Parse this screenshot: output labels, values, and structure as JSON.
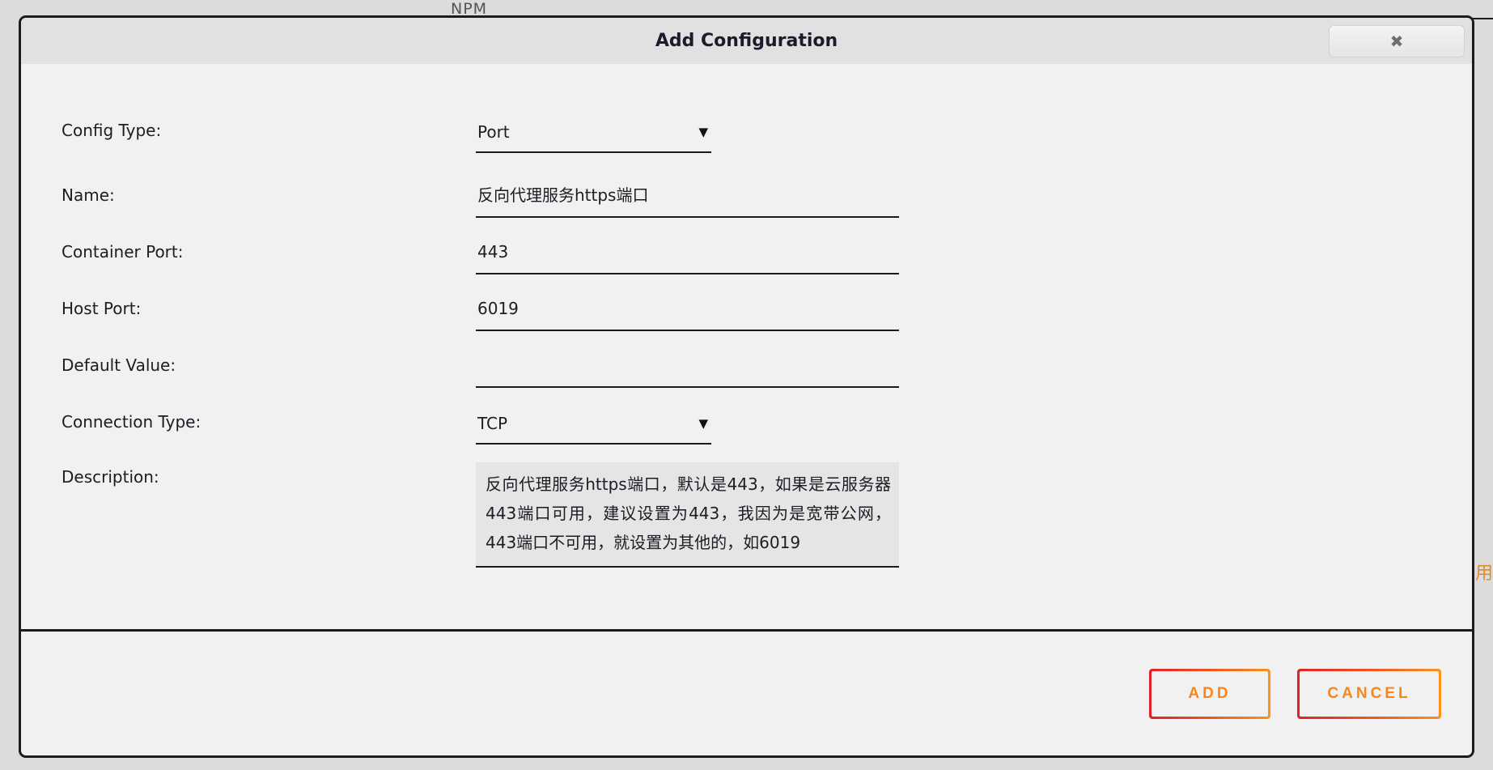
{
  "background": {
    "npm_label": "NPM",
    "partial_glyph": "用"
  },
  "dialog": {
    "title": "Add Configuration",
    "close_icon": "✖",
    "caret_icon": "▼",
    "form": {
      "rows": [
        {
          "label": "Config Type:",
          "type": "select",
          "value": "Port",
          "name": "config-type"
        },
        {
          "label": "Name:",
          "type": "input",
          "value": "反向代理服务https端口",
          "placeholder": "",
          "name": "name"
        },
        {
          "label": "Container Port:",
          "type": "input",
          "value": "443",
          "placeholder": "",
          "name": "container-port"
        },
        {
          "label": "Host Port:",
          "type": "input",
          "value": "6019",
          "placeholder": "",
          "name": "host-port"
        },
        {
          "label": "Default Value:",
          "type": "input",
          "value": "",
          "placeholder": "",
          "name": "default-value"
        },
        {
          "label": "Connection Type:",
          "type": "select",
          "value": "TCP",
          "name": "connection-type"
        },
        {
          "label": "Description:",
          "type": "textarea",
          "value": "反向代理服务https端口，默认是443，如果是云服务器443端口可用，建议设置为443，我因为是宽带公网，443端口不可用，就设置为其他的，如6019",
          "placeholder": "",
          "name": "description"
        }
      ]
    },
    "footer": {
      "add_label": "ADD",
      "cancel_label": "CANCEL"
    }
  },
  "colors": {
    "accent_red": "#e02029",
    "accent_orange": "#f7941e",
    "button_text": "#f7861c",
    "dialog_bg": "#f1f1f1",
    "header_bg": "#e1e1e1",
    "page_bg": "#dcdcdc",
    "border": "#1c1c1c",
    "textarea_bg": "#e5e5e5"
  }
}
